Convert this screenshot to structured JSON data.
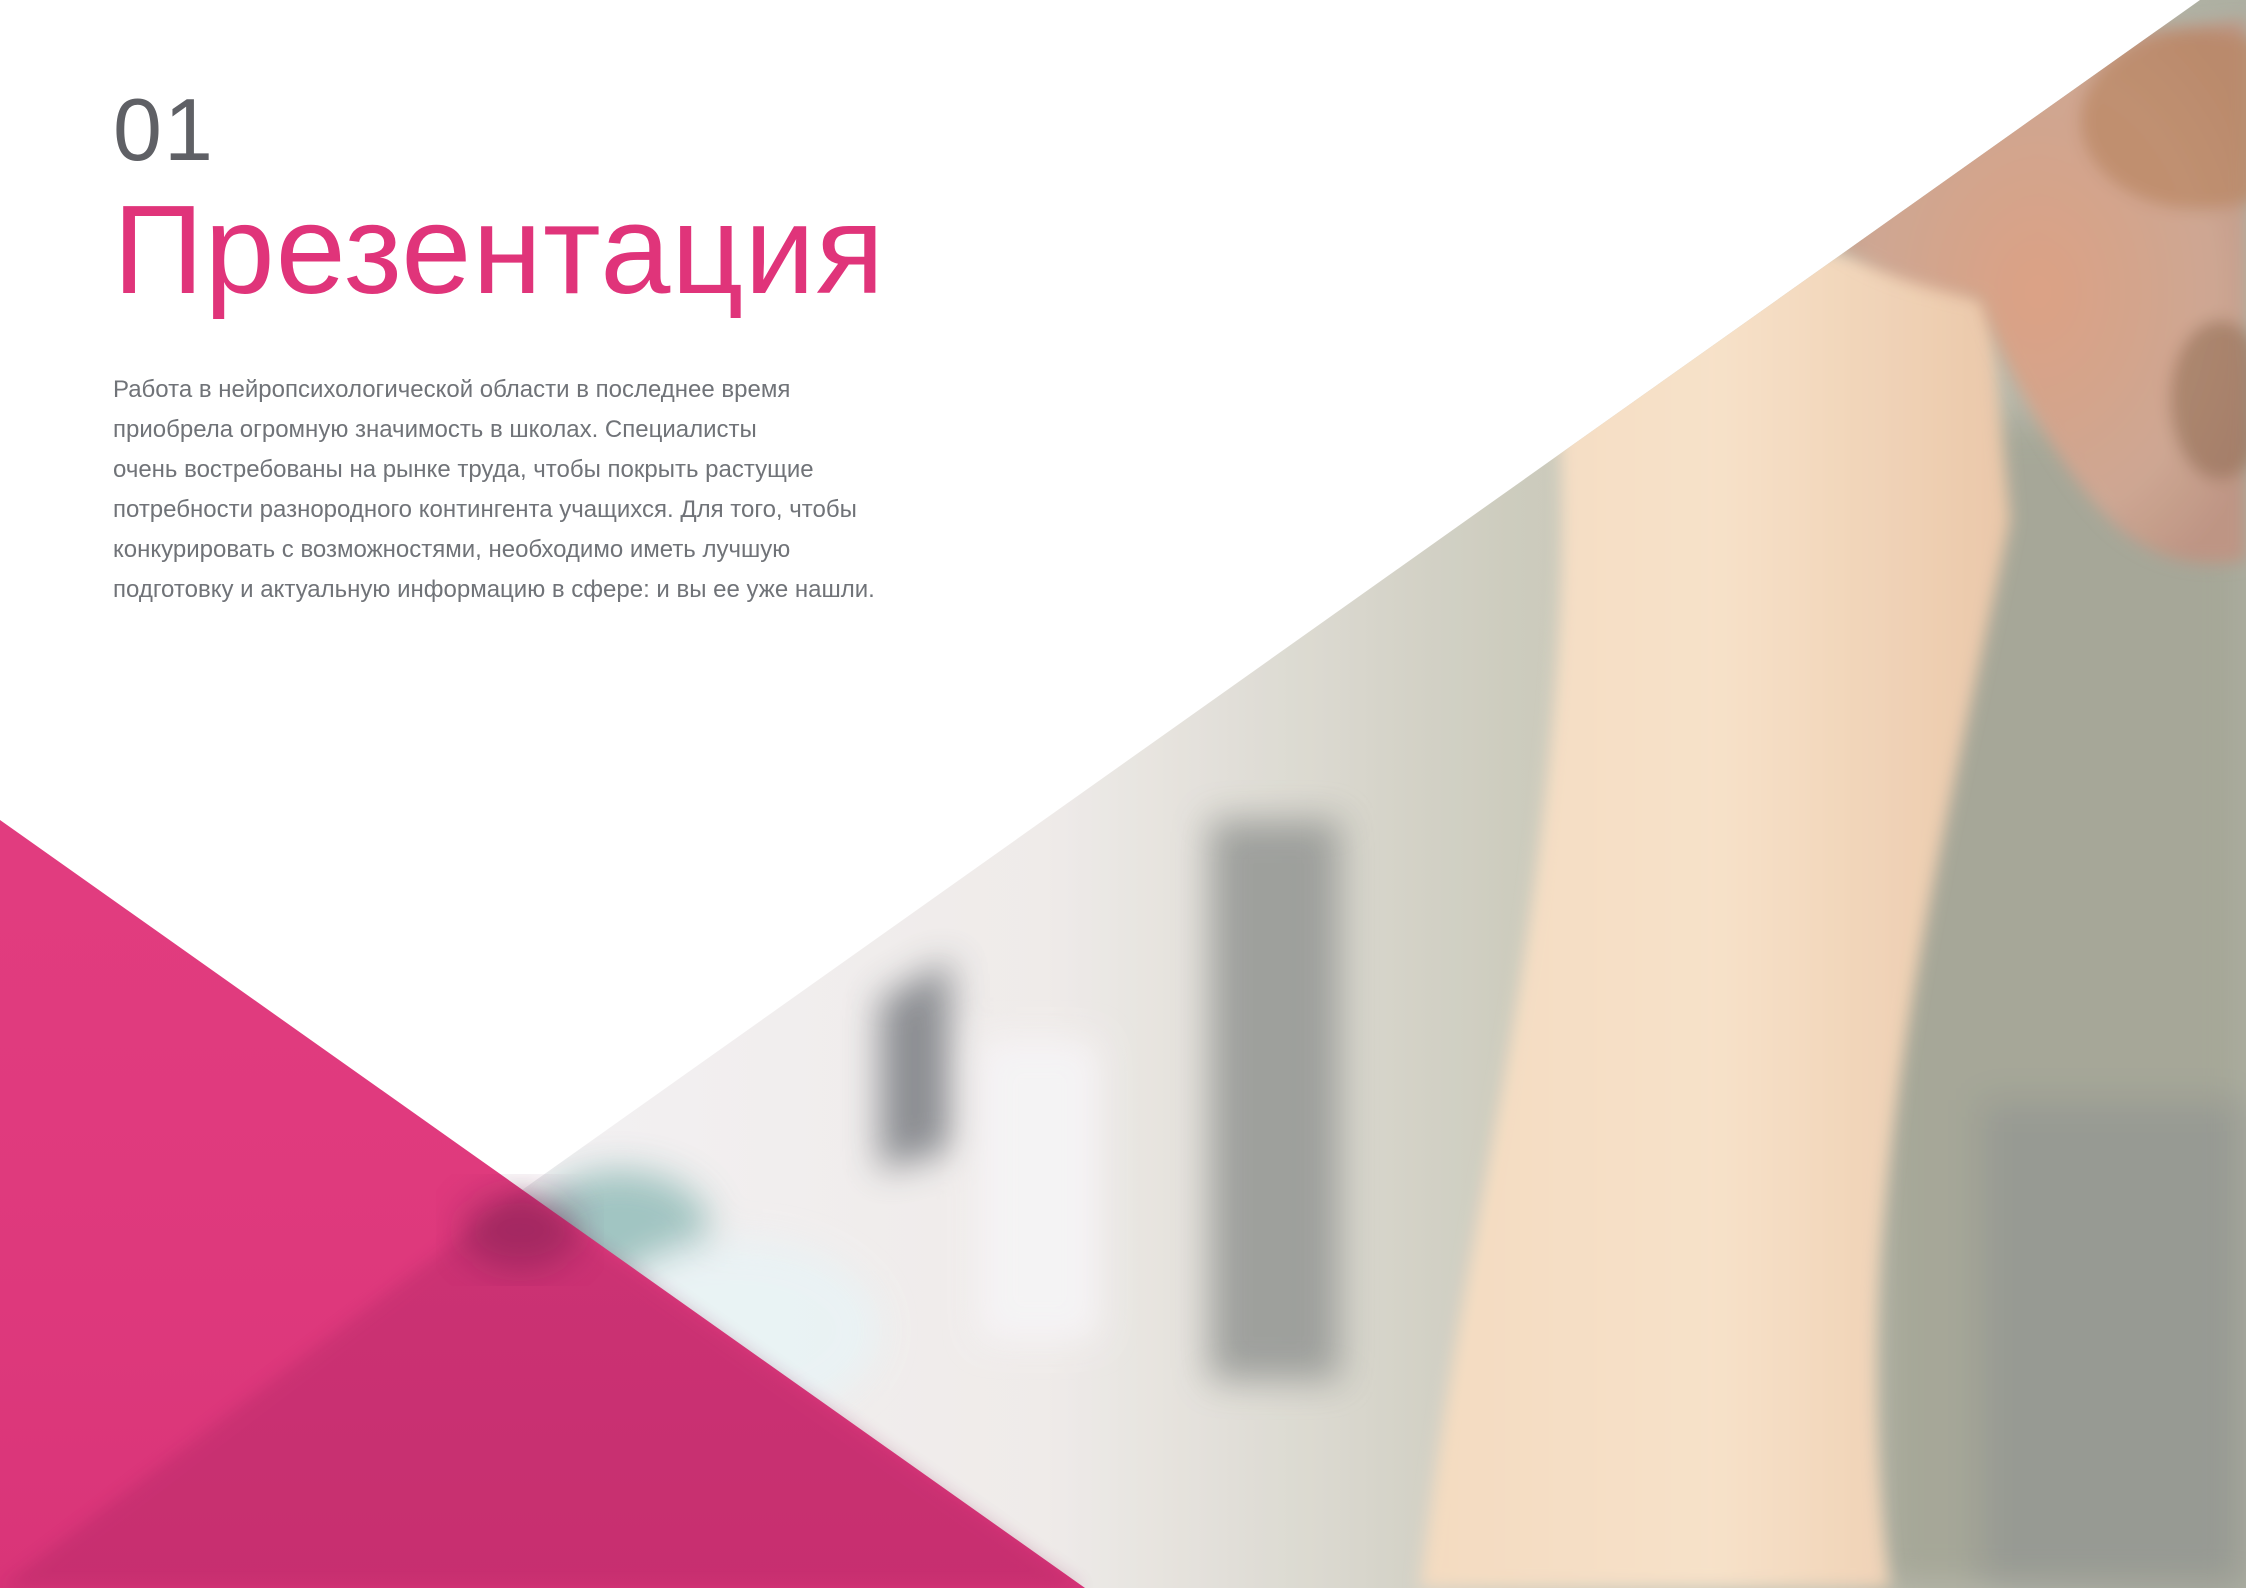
{
  "page": {
    "number": "01",
    "title": "Презентация",
    "body_lines": [
      "Работа в нейропсихологической области в последнее время",
      "приобрела огромную значимость в школах. Специалисты",
      "очень востребованы на рынке труда, чтобы покрыть растущие",
      "потребности разнородного контингента учащихся. Для того, чтобы",
      "конкурировать с возможностями, необходимо иметь лучшую",
      "подготовку и актуальную информацию в сфере: и вы ее уже нашли."
    ]
  },
  "colors": {
    "accent_pink": "#e0347a",
    "number_gray": "#5f6065",
    "body_gray": "#707378",
    "background": "#ffffff"
  },
  "photo": {
    "subject": "blurred photo of a person's forearm raised to the head, soft background"
  }
}
